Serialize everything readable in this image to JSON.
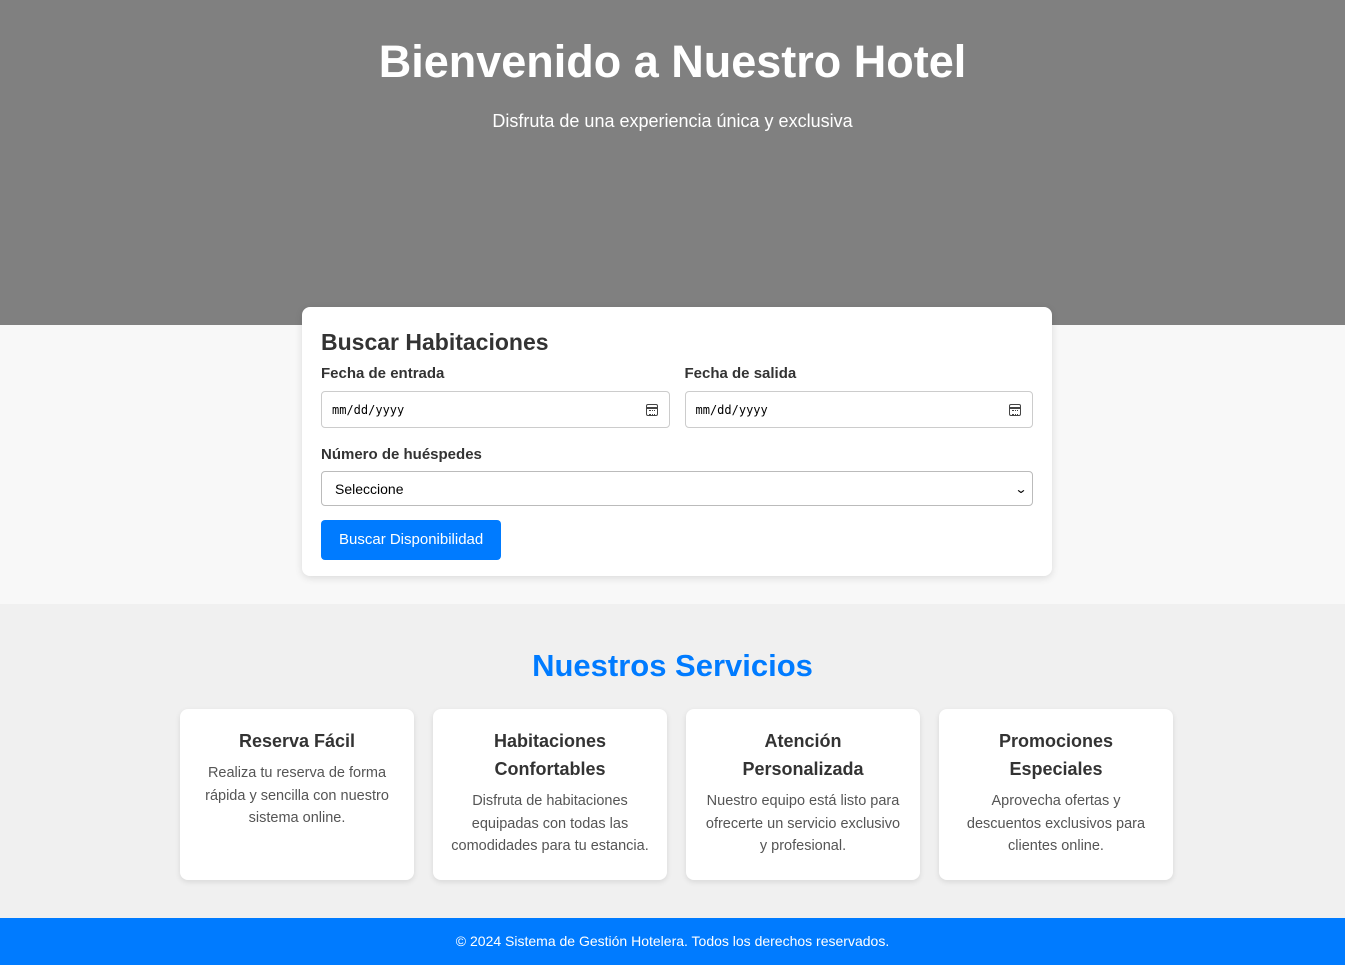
{
  "hero": {
    "title": "Bienvenido a Nuestro Hotel",
    "subtitle": "Disfruta de una experiencia única y exclusiva"
  },
  "search": {
    "title": "Buscar Habitaciones",
    "checkin_label": "Fecha de entrada",
    "checkin_value": "mm/dd/yyyy",
    "checkout_label": "Fecha de salida",
    "checkout_value": "mm/dd/yyyy",
    "guests_label": "Número de huéspedes",
    "guests_selected": "Seleccione",
    "button_label": "Buscar Disponibilidad"
  },
  "services": {
    "title": "Nuestros Servicios",
    "items": [
      {
        "title": "Reserva Fácil",
        "text": "Realiza tu reserva de forma rápida y sencilla con nuestro sistema online."
      },
      {
        "title": "Habitaciones Confortables",
        "text": "Disfruta de habitaciones equipadas con todas las comodidades para tu estancia."
      },
      {
        "title": "Atención Personalizada",
        "text": "Nuestro equipo está listo para ofrecerte un servicio exclusivo y profesional."
      },
      {
        "title": "Promociones Especiales",
        "text": "Aprovecha ofertas y descuentos exclusivos para clientes online."
      }
    ]
  },
  "footer": {
    "text": "© 2024 Sistema de Gestión Hotelera. Todos los derechos reservados."
  },
  "colors": {
    "accent": "#007bff",
    "hero_bg": "#808080",
    "services_bg": "#f0f0f0"
  },
  "icons": {
    "date_picker": "calendar-icon",
    "select_arrow": "chevron-down-icon"
  }
}
